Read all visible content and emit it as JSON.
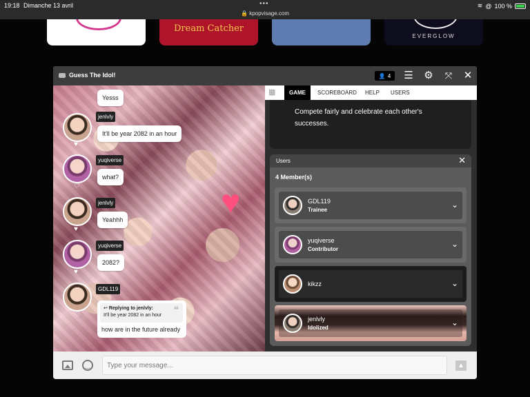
{
  "status_bar": {
    "time": "19:18",
    "date": "Dimanche 13 avril",
    "url": "kpopvisage.com",
    "battery": "100 %"
  },
  "background_cards": [
    {
      "label": ""
    },
    {
      "label": "Dream Catcher"
    },
    {
      "label": ""
    },
    {
      "label": "EVERGLOW"
    }
  ],
  "modal": {
    "title": "Guess The Idol!",
    "user_count": "4"
  },
  "tabs": [
    {
      "label": "GAME",
      "active": true
    },
    {
      "label": "SCOREBOARD",
      "active": false
    },
    {
      "label": "HELP",
      "active": false
    },
    {
      "label": "USERS",
      "active": false
    }
  ],
  "info_text": "Compete fairly and celebrate each other's successes.",
  "chat": {
    "messages": [
      {
        "user": "",
        "text": "Yesss"
      },
      {
        "user": "jenlvly",
        "text": "It'll be year 2082 in an hour"
      },
      {
        "user": "yuqiverse",
        "text": "what?"
      },
      {
        "user": "jenlvly",
        "text": "Yeahhh"
      },
      {
        "user": "yuqiverse",
        "text": "2082?"
      },
      {
        "user": "GDL119",
        "text": "how are in the future already"
      }
    ],
    "reply": {
      "header": "Replying to jenlvly:",
      "quoted": "It'll be year 2082 in an hour"
    }
  },
  "users_panel": {
    "title": "Users",
    "members_label": "4 Member(s)",
    "users": [
      {
        "name": "GDL119",
        "role": "Trainee"
      },
      {
        "name": "yuqiverse",
        "role": "Contributor"
      },
      {
        "name": "kikzz",
        "role": ""
      },
      {
        "name": "jenlvly",
        "role": "Idolized"
      }
    ]
  },
  "input": {
    "placeholder": "Type your message..."
  },
  "colors": {
    "modal_header": "#3d3d3d",
    "active_tab": "#000000",
    "heart": "#ff4f7e"
  }
}
